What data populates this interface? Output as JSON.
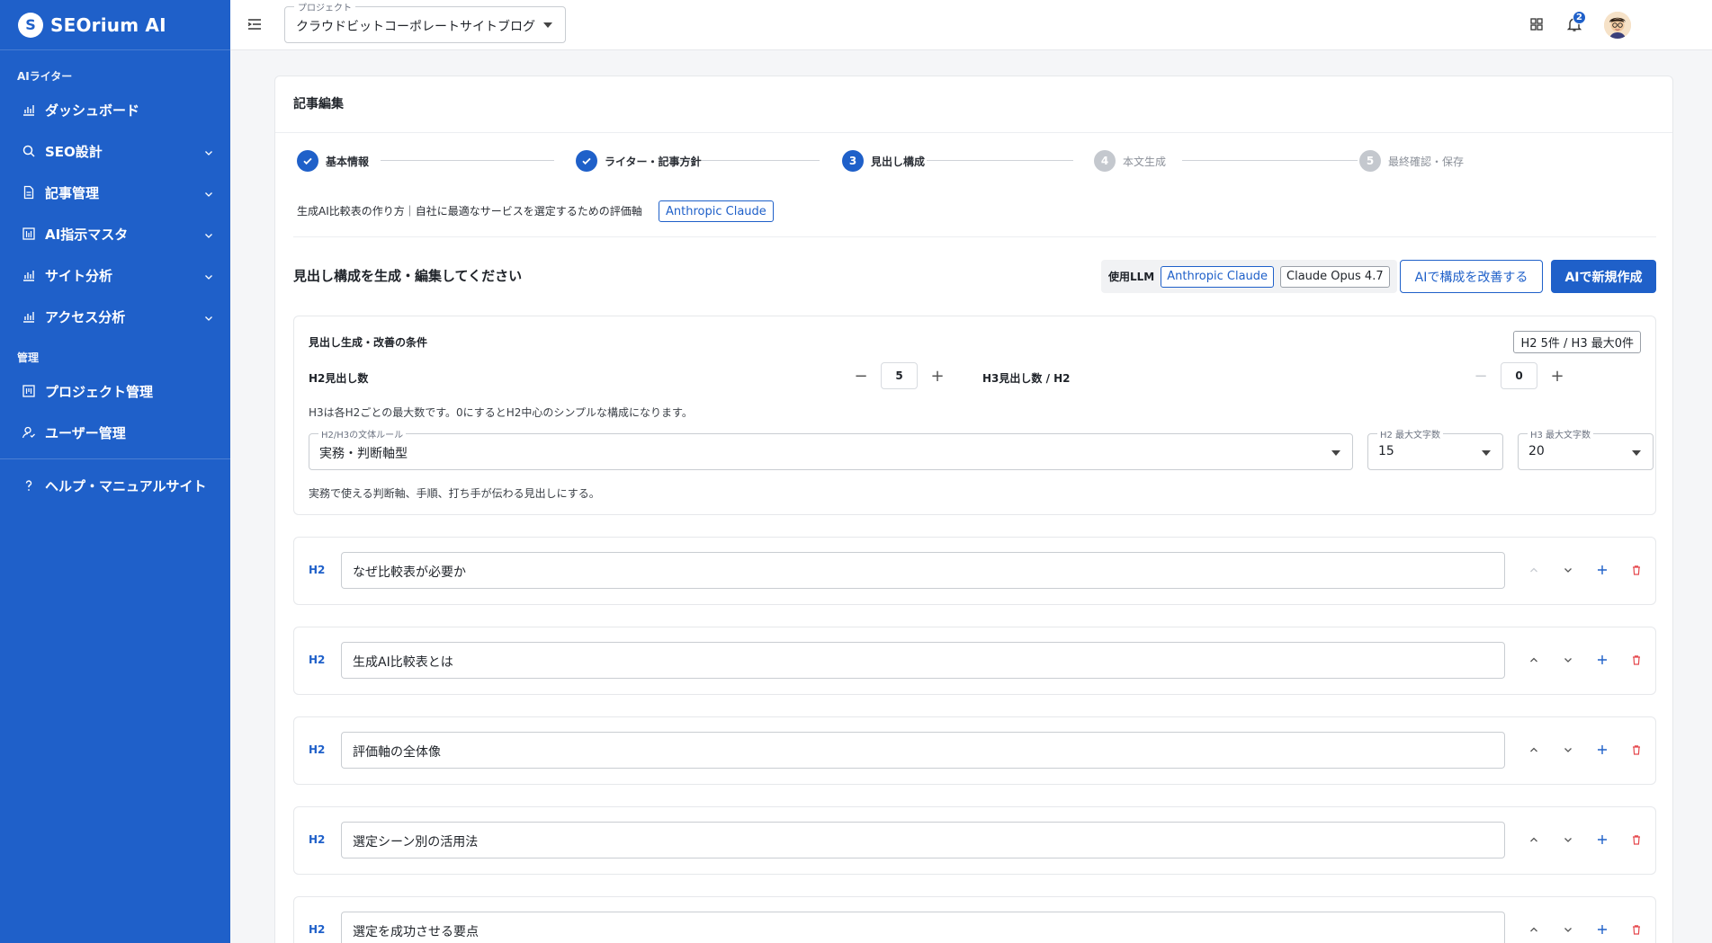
{
  "app": {
    "logo_letter": "S",
    "name": "SEOrium AI"
  },
  "sidebar": {
    "section_ai": "AIライター",
    "items_ai": [
      {
        "label": "ダッシュボード",
        "icon": "bar-chart-icon",
        "expandable": false
      },
      {
        "label": "SEO設計",
        "icon": "search-icon",
        "expandable": true
      },
      {
        "label": "記事管理",
        "icon": "document-icon",
        "expandable": true
      },
      {
        "label": "AI指示マスタ",
        "icon": "template-icon",
        "expandable": true
      },
      {
        "label": "サイト分析",
        "icon": "bar-chart-icon",
        "expandable": true
      },
      {
        "label": "アクセス分析",
        "icon": "bar-chart-icon",
        "expandable": true
      }
    ],
    "section_admin": "管理",
    "items_admin": [
      {
        "label": "プロジェクト管理",
        "icon": "project-icon"
      },
      {
        "label": "ユーザー管理",
        "icon": "user-icon"
      }
    ],
    "help": {
      "label": "ヘルプ・マニュアルサイト",
      "icon": "help-icon"
    }
  },
  "topbar": {
    "project_legend": "プロジェクト",
    "project_value": "クラウドビットコーポレートサイトブログ",
    "notification_count": "2"
  },
  "card": {
    "title": "記事編集",
    "steps": [
      {
        "num": "1",
        "label": "基本情報",
        "state": "done"
      },
      {
        "num": "2",
        "label": "ライター・記事方針",
        "state": "done"
      },
      {
        "num": "3",
        "label": "見出し構成",
        "state": "active"
      },
      {
        "num": "4",
        "label": "本文生成",
        "state": "pending"
      },
      {
        "num": "5",
        "label": "最終確認・保存",
        "state": "pending"
      }
    ],
    "article_title": "生成AI比較表の作り方｜自社に最適なサービスを選定するための評価軸",
    "article_llm": "Anthropic Claude",
    "section_heading": "見出し構成を生成・編集してください",
    "llm_label": "使用LLM",
    "llm_provider": "Anthropic Claude",
    "llm_model": "Claude Opus 4.7",
    "improve_button": "AIで構成を改善する",
    "create_button": "AIで新規作成"
  },
  "conditions": {
    "title": "見出し生成・改善の条件",
    "summary": "H2 5件 / H3 最大0件",
    "h2_label": "H2見出し数",
    "h2_count": "5",
    "h3_label": "H3見出し数 / H2",
    "h3_count": "0",
    "note": "H3は各H2ごとの最大数です。0にするとH2中心のシンプルな構成になります。",
    "style_legend": "H2/H3の文体ルール",
    "style_value": "実務・判断軸型",
    "h2_max_legend": "H2 最大文字数",
    "h2_max_value": "15",
    "h3_max_legend": "H3 最大文字数",
    "h3_max_value": "20",
    "style_desc": "実務で使える判断軸、手順、打ち手が伝わる見出しにする。"
  },
  "headings": [
    {
      "level": "H2",
      "text": "なぜ比較表が必要か"
    },
    {
      "level": "H2",
      "text": "生成AI比較表とは"
    },
    {
      "level": "H2",
      "text": "評価軸の全体像"
    },
    {
      "level": "H2",
      "text": "選定シーン別の活用法"
    },
    {
      "level": "H2",
      "text": "選定を成功させる要点"
    }
  ],
  "colors": {
    "primary": "#1f60c9",
    "danger": "#e5484d",
    "pending": "#c4c8ce"
  }
}
